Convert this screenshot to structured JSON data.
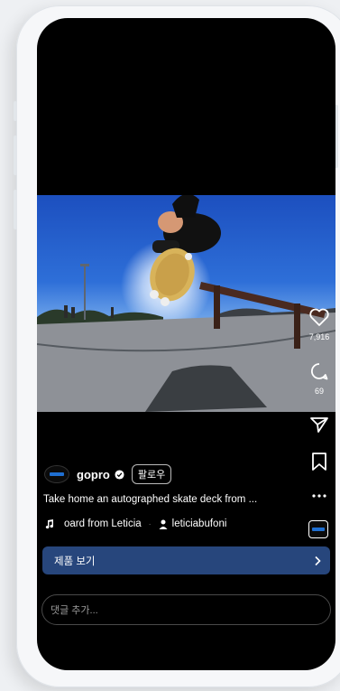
{
  "post": {
    "username": "gopro",
    "follow_label": "팔로우",
    "caption": "Take home an autographed skate deck from ...",
    "audio_text": "oard from Leticia",
    "tagged_user": "leticiabufoni",
    "product_button_label": "제품 보기",
    "comment_placeholder": "댓글 추가..."
  },
  "actions": {
    "like_count": "7,916",
    "comment_count": "69"
  },
  "colors": {
    "product_bar": "#27467c",
    "screen_bg": "#000000",
    "frame_bg": "#f6f7f9"
  },
  "icons": {
    "like": "heart-icon",
    "comment": "comment-icon",
    "share": "send-icon",
    "save": "bookmark-icon",
    "more": "more-icon",
    "audio": "music-note-icon",
    "person": "person-icon",
    "chevron": "chevron-right-icon",
    "verified": "verified-badge-icon"
  }
}
